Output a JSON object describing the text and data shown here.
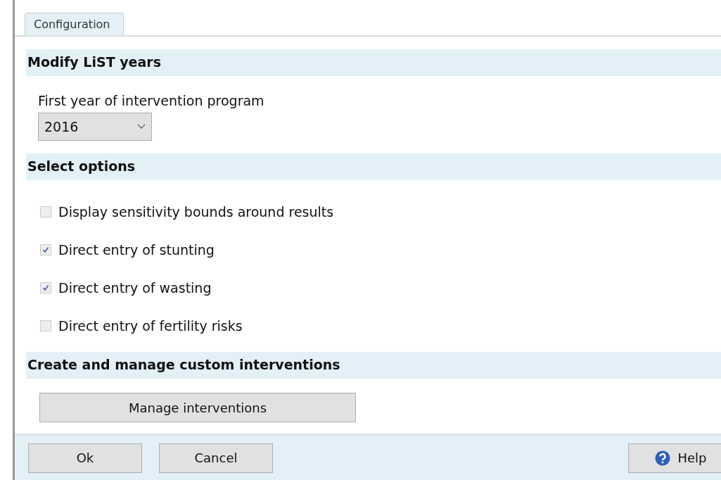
{
  "tabs": [
    {
      "label": "Configuration",
      "selected": true
    }
  ],
  "sections": [
    {
      "title": "Modify LiST years",
      "kind": "select",
      "label": "First year of intervention program",
      "value": "2016"
    },
    {
      "title": "Select options",
      "kind": "checkboxes",
      "options": [
        {
          "label": "Display sensitivity bounds around results",
          "checked": false
        },
        {
          "label": "Direct entry of stunting",
          "checked": true
        },
        {
          "label": "Direct entry of wasting",
          "checked": true
        },
        {
          "label": "Direct entry of fertility risks",
          "checked": false
        }
      ]
    },
    {
      "title": "Create and manage custom interventions",
      "kind": "button",
      "button": "Manage interventions"
    }
  ],
  "footer": {
    "buttons": [
      "Ok",
      "Cancel"
    ],
    "help": "Help"
  }
}
